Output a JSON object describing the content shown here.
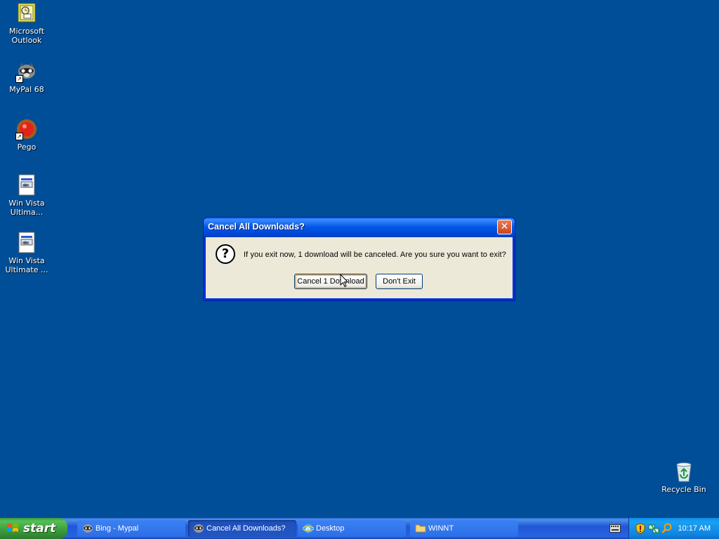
{
  "desktop": {
    "icons": [
      {
        "label": "Microsoft Outlook",
        "icon": "outlook-icon"
      },
      {
        "label": "MyPal 68",
        "icon": "mypal-icon"
      },
      {
        "label": "Pego",
        "icon": "pego-icon"
      },
      {
        "label": "Win Vista Ultima...",
        "icon": "document-icon"
      },
      {
        "label": "Win Vista Ultimate ...",
        "icon": "document-icon"
      }
    ],
    "recycle_bin": {
      "label": "Recycle Bin",
      "icon": "recycle-bin-icon"
    },
    "background_color": "#004e98"
  },
  "dialog": {
    "title": "Cancel All Downloads?",
    "icon": "question-icon",
    "message": "If you exit now, 1 download will be canceled. Are you sure you want to exit?",
    "primary_button": "Cancel 1 Download",
    "secondary_button": "Don't Exit"
  },
  "taskbar": {
    "start_label": "start",
    "tasks": [
      {
        "label": "Bing - Mypal",
        "icon": "mypal-icon",
        "active": false
      },
      {
        "label": "Cancel All Downloads?",
        "icon": "mypal-icon",
        "active": true
      },
      {
        "label": "Desktop",
        "icon": "ie-icon",
        "active": false
      },
      {
        "label": "WINNT",
        "icon": "folder-icon",
        "active": false
      }
    ],
    "tray": {
      "icons": [
        "keyboard-icon",
        "shield-icon",
        "network-icon",
        "search-icon"
      ],
      "clock": "10:17 AM"
    }
  }
}
